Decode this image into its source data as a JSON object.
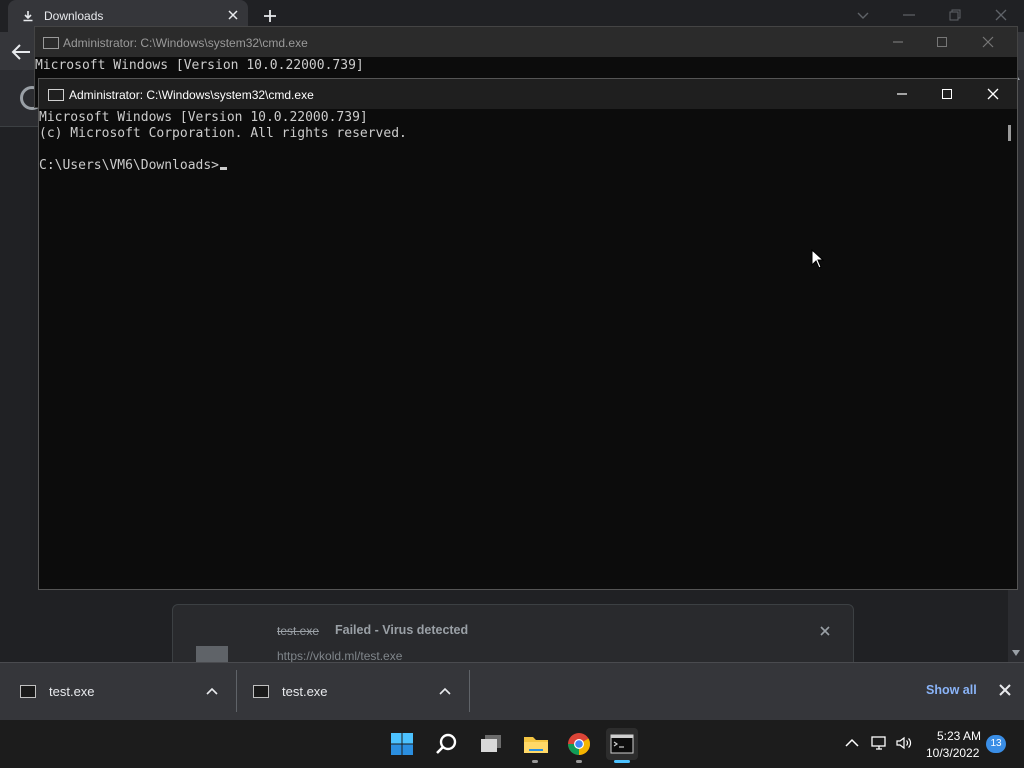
{
  "browser": {
    "tab_title": "Downloads",
    "download_card": {
      "filename": "test.exe",
      "status": "Failed - Virus detected",
      "url": "https://vkold.ml/test.exe"
    }
  },
  "cmd_background": {
    "title": "Administrator: C:\\Windows\\system32\\cmd.exe",
    "line1": "Microsoft Windows [Version 10.0.22000.739]"
  },
  "cmd_foreground": {
    "title": "Administrator: C:\\Windows\\system32\\cmd.exe",
    "line1": "Microsoft Windows [Version 10.0.22000.739]",
    "line2": "(c) Microsoft Corporation. All rights reserved.",
    "prompt": "C:\\Users\\VM6\\Downloads>"
  },
  "shelf": {
    "items": [
      {
        "label": "test.exe"
      },
      {
        "label": "test.exe"
      }
    ],
    "show_all": "Show all"
  },
  "taskbar": {
    "time": "5:23 AM",
    "date": "10/3/2022",
    "notification_count": "13",
    "icons": [
      "windows-start-icon",
      "search-icon",
      "task-view-icon",
      "file-explorer-icon",
      "chrome-icon",
      "terminal-icon"
    ]
  }
}
